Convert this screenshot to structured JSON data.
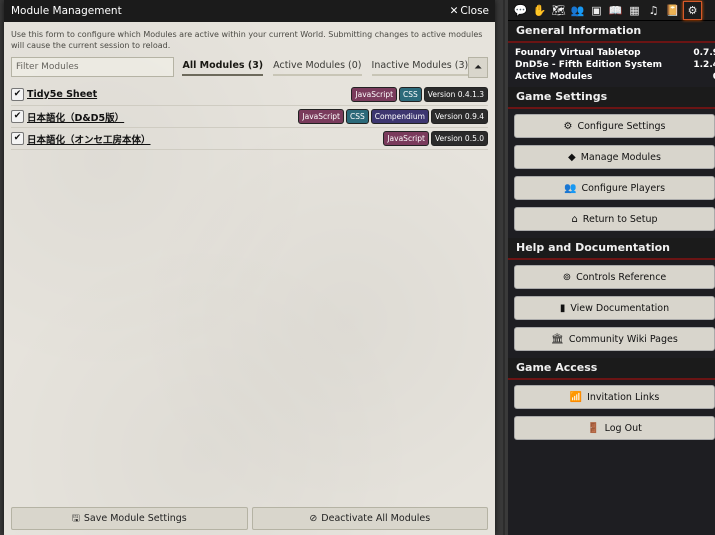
{
  "window": {
    "title": "Module Management",
    "close_label": "Close",
    "intro": "Use this form to configure which Modules are active within your current World. Submitting changes to active modules will cause the current session to reload.",
    "filter_placeholder": "Filter Modules",
    "tabs": [
      {
        "label": "All Modules (3)"
      },
      {
        "label": "Active Modules (0)"
      },
      {
        "label": "Inactive Modules (3)"
      }
    ],
    "modules": [
      {
        "title": "Tidy5e Sheet",
        "tags": [
          "JavaScript",
          "CSS"
        ],
        "version": "Version 0.4.1.3"
      },
      {
        "title": "日本語化（D&D5版）",
        "tags": [
          "JavaScript",
          "CSS",
          "Compendium"
        ],
        "version": "Version 0.9.4"
      },
      {
        "title": "日本語化（オンセ工房本体）",
        "tags": [
          "JavaScript"
        ],
        "version": "Version 0.5.0"
      }
    ],
    "save_label": "Save Module Settings",
    "deactivate_label": "Deactivate All Modules"
  },
  "sidebar": {
    "tab_icons": [
      "chat-icon",
      "dice-icon",
      "map-icon",
      "users-icon",
      "cube-icon",
      "journal-icon",
      "table-icon",
      "music-icon",
      "compendium-icon",
      "settings-icon"
    ],
    "general_header": "General Information",
    "info": [
      {
        "label": "Foundry Virtual Tabletop",
        "value": "0.7.9"
      },
      {
        "label": "DnD5e - Fifth Edition System",
        "value": "1.2.4"
      },
      {
        "label": "Active Modules",
        "value": "0"
      }
    ],
    "game_settings_header": "Game Settings",
    "game_settings_buttons": [
      "Configure Settings",
      "Manage Modules",
      "Configure Players",
      "Return to Setup"
    ],
    "help_header": "Help and Documentation",
    "help_buttons": [
      "Controls Reference",
      "View Documentation",
      "Community Wiki Pages"
    ],
    "access_header": "Game Access",
    "access_buttons": [
      "Invitation Links",
      "Log Out"
    ]
  }
}
